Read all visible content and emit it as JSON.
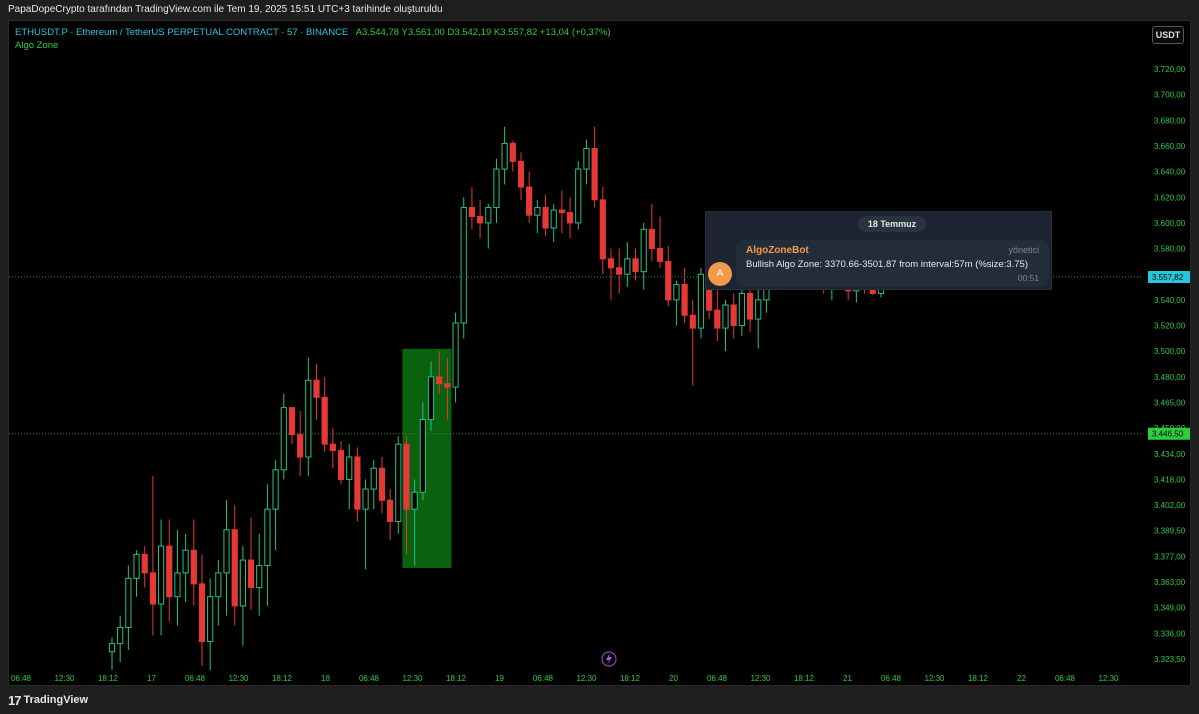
{
  "top_bar": {
    "text": "PapaDopeCrypto tarafından TradingView.com ile Tem 19, 2025 15:51 UTC+3 tarihinde oluşturuldu"
  },
  "header": {
    "symbol": "ETHUSDT.P · Ethereum / TetherUS PERPETUAL CONTRACT · 57 · BINANCE",
    "ohlc": "A3.544,78  Y3.561,00  D3.542,19  K3.557,82  +13,04 (+0,37%)",
    "indicator": "Algo Zone",
    "currency_button": "USDT"
  },
  "telegram": {
    "date": "18 Temmuz",
    "avatar_letter": "A",
    "sender": "AlgoZoneBot",
    "role": "yönetici",
    "message": "Bullish Algo Zone: 3370.66-3501.87 from interval:57m (%size:3.75)",
    "time": "00:51"
  },
  "footer": {
    "logo_glyph": "17",
    "brand": "TradingView"
  },
  "colors": {
    "up": "#26c281",
    "down": "#e53935",
    "zone": "#0b6b12",
    "price_label": "#26c6da",
    "zone_label": "#2ecc40",
    "axis_text": "#2ecc40"
  },
  "icons": {
    "lightning": "lightning-icon"
  },
  "chart_data": {
    "type": "candlestick",
    "title": "ETHUSDT.P · Ethereum / TetherUS PERPETUAL CONTRACT · 57 · BINANCE",
    "y_ticks": [
      "3.720,00",
      "3.700,00",
      "3.680,00",
      "3.660,00",
      "3.640,00",
      "3.620,00",
      "3.600,00",
      "3.580,00",
      "3.560,00",
      "3.540,00",
      "3.520,00",
      "3.500,00",
      "3.480,00",
      "3.465,00",
      "3.450,00",
      "3.434,00",
      "3.418,00",
      "3.402,00",
      "3.389,50",
      "3.377,00",
      "3.363,00",
      "3.349,00",
      "3.336,00",
      "3.323,50"
    ],
    "x_ticks": [
      "06:48",
      "12:30",
      "18:12",
      "17",
      "06:48",
      "12:30",
      "18:12",
      "18",
      "06:48",
      "12:30",
      "18:12",
      "19",
      "06:48",
      "12:30",
      "18:12",
      "20",
      "06:48",
      "12:30",
      "18:12",
      "21",
      "06:48",
      "12:30",
      "18:12",
      "22",
      "06:48",
      "12:30"
    ],
    "x_tick_bars": [
      0,
      5,
      10,
      15,
      20,
      25,
      30,
      35,
      40,
      45,
      50,
      55,
      60,
      65,
      70,
      75,
      80,
      85,
      90,
      95,
      100,
      105,
      110,
      115,
      120,
      125
    ],
    "price_labels": [
      {
        "value": 3557.82,
        "text": "3.557,82"
      },
      {
        "value": 3446.5,
        "text": "3.446,50"
      }
    ],
    "zone": {
      "low": 3370.66,
      "high": 3501.87,
      "start_bar": 36,
      "end_bar": 41
    },
    "candles": [
      [
        3327,
        3334,
        3318,
        3331
      ],
      [
        3331,
        3345,
        3322,
        3339
      ],
      [
        3339,
        3372,
        3328,
        3365
      ],
      [
        3365,
        3380,
        3355,
        3378
      ],
      [
        3378,
        3382,
        3360,
        3368
      ],
      [
        3368,
        3420,
        3335,
        3351
      ],
      [
        3351,
        3395,
        3335,
        3382
      ],
      [
        3382,
        3395,
        3342,
        3355
      ],
      [
        3355,
        3390,
        3340,
        3368
      ],
      [
        3368,
        3388,
        3352,
        3380
      ],
      [
        3380,
        3395,
        3350,
        3362
      ],
      [
        3362,
        3378,
        3320,
        3332
      ],
      [
        3332,
        3365,
        3318,
        3355
      ],
      [
        3355,
        3375,
        3340,
        3368
      ],
      [
        3368,
        3405,
        3345,
        3390
      ],
      [
        3390,
        3402,
        3340,
        3350
      ],
      [
        3350,
        3382,
        3330,
        3375
      ],
      [
        3375,
        3396,
        3348,
        3360
      ],
      [
        3360,
        3388,
        3345,
        3372
      ],
      [
        3372,
        3415,
        3350,
        3400
      ],
      [
        3400,
        3430,
        3380,
        3424
      ],
      [
        3424,
        3470,
        3418,
        3462
      ],
      [
        3462,
        3458,
        3440,
        3446
      ],
      [
        3446,
        3460,
        3420,
        3432
      ],
      [
        3432,
        3495,
        3420,
        3478
      ],
      [
        3478,
        3490,
        3455,
        3468
      ],
      [
        3468,
        3480,
        3435,
        3440
      ],
      [
        3440,
        3450,
        3425,
        3436
      ],
      [
        3436,
        3442,
        3415,
        3418
      ],
      [
        3418,
        3440,
        3400,
        3432
      ],
      [
        3432,
        3438,
        3394,
        3400
      ],
      [
        3400,
        3418,
        3370,
        3412
      ],
      [
        3412,
        3430,
        3400,
        3425
      ],
      [
        3425,
        3432,
        3398,
        3405
      ],
      [
        3405,
        3412,
        3385,
        3394
      ],
      [
        3394,
        3445,
        3388,
        3440
      ],
      [
        3440,
        3445,
        3378,
        3400
      ],
      [
        3400,
        3418,
        3372,
        3410
      ],
      [
        3410,
        3465,
        3405,
        3455
      ],
      [
        3455,
        3492,
        3448,
        3480
      ],
      [
        3480,
        3500,
        3470,
        3476
      ],
      [
        3476,
        3495,
        3455,
        3474
      ],
      [
        3474,
        3530,
        3465,
        3522
      ],
      [
        3522,
        3620,
        3510,
        3612
      ],
      [
        3612,
        3628,
        3595,
        3605
      ],
      [
        3605,
        3618,
        3588,
        3600
      ],
      [
        3600,
        3615,
        3580,
        3612
      ],
      [
        3612,
        3650,
        3600,
        3642
      ],
      [
        3642,
        3675,
        3630,
        3662
      ],
      [
        3662,
        3664,
        3640,
        3648
      ],
      [
        3648,
        3655,
        3618,
        3628
      ],
      [
        3628,
        3640,
        3600,
        3606
      ],
      [
        3606,
        3618,
        3592,
        3612
      ],
      [
        3612,
        3622,
        3590,
        3596
      ],
      [
        3596,
        3615,
        3585,
        3610
      ],
      [
        3610,
        3625,
        3592,
        3608
      ],
      [
        3608,
        3620,
        3588,
        3600
      ],
      [
        3600,
        3648,
        3595,
        3642
      ],
      [
        3642,
        3665,
        3630,
        3658
      ],
      [
        3658,
        3675,
        3612,
        3618
      ],
      [
        3618,
        3628,
        3560,
        3572
      ],
      [
        3572,
        3580,
        3540,
        3565
      ],
      [
        3565,
        3580,
        3545,
        3560
      ],
      [
        3560,
        3585,
        3550,
        3572
      ],
      [
        3572,
        3580,
        3555,
        3562
      ],
      [
        3562,
        3600,
        3548,
        3595
      ],
      [
        3595,
        3615,
        3570,
        3580
      ],
      [
        3580,
        3605,
        3565,
        3570
      ],
      [
        3570,
        3582,
        3535,
        3540
      ],
      [
        3540,
        3555,
        3520,
        3552
      ],
      [
        3552,
        3565,
        3522,
        3528
      ],
      [
        3528,
        3540,
        3475,
        3518
      ],
      [
        3518,
        3565,
        3510,
        3560
      ],
      [
        3560,
        3568,
        3525,
        3532
      ],
      [
        3532,
        3548,
        3508,
        3518
      ],
      [
        3518,
        3540,
        3500,
        3536
      ],
      [
        3536,
        3545,
        3510,
        3520
      ],
      [
        3520,
        3550,
        3512,
        3545
      ],
      [
        3545,
        3555,
        3515,
        3525
      ],
      [
        3525,
        3550,
        3502,
        3540
      ],
      [
        3540,
        3570,
        3530,
        3565
      ],
      [
        3565,
        3595,
        3555,
        3588
      ],
      [
        3588,
        3608,
        3570,
        3582
      ],
      [
        3582,
        3596,
        3562,
        3575
      ],
      [
        3575,
        3602,
        3560,
        3592
      ],
      [
        3592,
        3600,
        3568,
        3578
      ],
      [
        3578,
        3588,
        3548,
        3560
      ],
      [
        3560,
        3570,
        3545,
        3552
      ],
      [
        3552,
        3575,
        3540,
        3565
      ],
      [
        3565,
        3576,
        3548,
        3555
      ],
      [
        3555,
        3566,
        3540,
        3547
      ],
      [
        3547,
        3568,
        3538,
        3562
      ],
      [
        3562,
        3575,
        3545,
        3558
      ],
      [
        3558,
        3572,
        3544,
        3545
      ],
      [
        3545,
        3560,
        3542,
        3557.82
      ]
    ]
  }
}
